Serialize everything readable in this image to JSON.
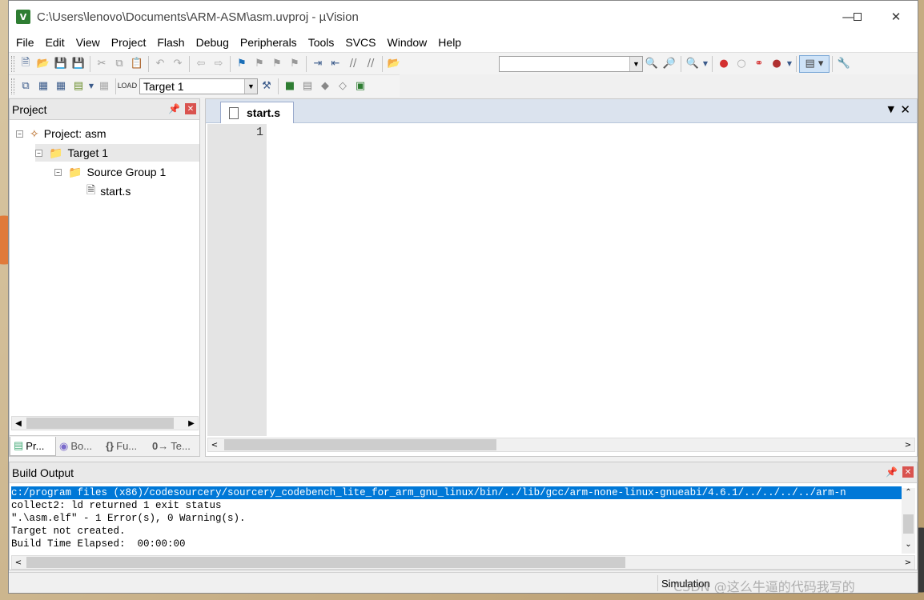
{
  "window": {
    "title": "C:\\Users\\lenovo\\Documents\\ARM-ASM\\asm.uvproj - µVision"
  },
  "menu": [
    "File",
    "Edit",
    "View",
    "Project",
    "Flash",
    "Debug",
    "Peripherals",
    "Tools",
    "SVCS",
    "Window",
    "Help"
  ],
  "toolbar2": {
    "target_value": "Target 1"
  },
  "project_pane": {
    "title": "Project",
    "tree": [
      {
        "label": "Project: asm",
        "icon": "project-icon"
      },
      {
        "label": "Target 1",
        "icon": "target-folder-icon"
      },
      {
        "label": "Source Group 1",
        "icon": "folder-icon"
      },
      {
        "label": "start.s",
        "icon": "file-icon"
      }
    ],
    "tabs": [
      "Pr...",
      "Bo...",
      "Fu...",
      "Te..."
    ]
  },
  "editor": {
    "tab_label": "start.s",
    "line_number": "1"
  },
  "build_output": {
    "title": "Build Output",
    "lines": [
      "c:/program files (x86)/codesourcery/sourcery_codebench_lite_for_arm_gnu_linux/bin/../lib/gcc/arm-none-linux-gnueabi/4.6.1/../../../../arm-n",
      "collect2: ld returned 1 exit status",
      "\".\\asm.elf\" - 1 Error(s), 0 Warning(s).",
      "Target not created.",
      "Build Time Elapsed:  00:00:00"
    ]
  },
  "status": {
    "mode": "Simulation"
  },
  "watermark": "CSDN @这么牛逼的代码我写的"
}
